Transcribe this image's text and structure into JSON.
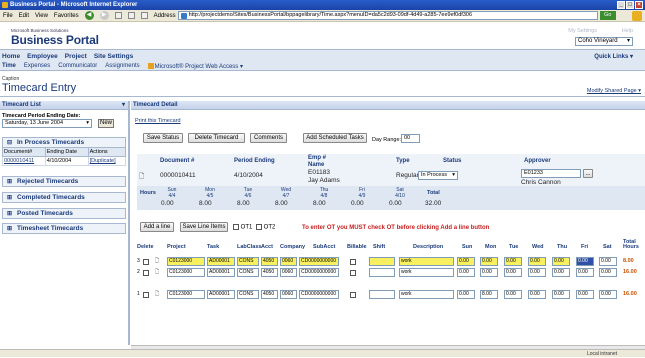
{
  "browser": {
    "title": "Business Portal - Microsoft Internet Explorer",
    "menu": [
      "File",
      "Edit",
      "View",
      "Favorites",
      "Tools",
      "Help"
    ],
    "address_label": "Address",
    "url": "http://projectdemo/Sites/BusinessPortal/bppagelibrary/Time.aspx?menuID=da5c2d93-09df-4d49-a285-7ee9ef0df306",
    "go_label": "Go",
    "status_zone": "Local intranet"
  },
  "portal": {
    "brand_small": "Microsoft Business Solutions",
    "brand": "Business Portal",
    "my_settings": "My Settings",
    "help": "Help",
    "site_select": "Coho Vineyard"
  },
  "nav": {
    "tabs": [
      "Home",
      "Employee",
      "Project",
      "Site Settings"
    ],
    "subtabs": [
      "Time",
      "Expenses",
      "Communicator",
      "Assignments",
      "Microsoft® Project Web Access"
    ],
    "quick_links": "Quick Links"
  },
  "page": {
    "caption": "Caption",
    "title": "Timecard Entry",
    "modify": "Modify Shared Page"
  },
  "timecard_list": {
    "header": "Timecard List",
    "period_label": "Timecard Period Ending Date:",
    "period_value": "Saturday, 13 June 2004",
    "new_button": "New",
    "in_process": "In Process Timecards",
    "table_headers": [
      "Document#",
      "Ending Date",
      "Actions"
    ],
    "rows": [
      {
        "doc": "0000010411",
        "date": "4/10/2004",
        "action": "[Duplicate]"
      }
    ],
    "rejected": "Rejected Timecards",
    "completed": "Completed Timecards",
    "posted": "Posted Timecards",
    "timesheet": "Timesheet Timecards"
  },
  "detail": {
    "header": "Timecard Detail",
    "print_link": "Print this Timecard",
    "save_status": "Save Status",
    "delete_timecard": "Delete Timecard",
    "comments": "Comments",
    "add_scheduled": "Add Scheduled Tasks",
    "day_range_label": "Day Range:",
    "day_range_value": "00",
    "summary_headers": {
      "document": "Document #",
      "period_ending": "Period Ending",
      "emp": "Emp #",
      "name": "Name",
      "type": "Type",
      "status": "Status",
      "approver": "Approver"
    },
    "summary_values": {
      "document": "0000010411",
      "period_ending": "4/10/2004",
      "emp": "E01183",
      "name": "Jay Adams",
      "type": "Regular",
      "status": "In Process",
      "approver_id": "E01233",
      "approver_name": "Chris Cannon",
      "lookup_button": "..."
    },
    "hours_label": "Hours",
    "hours_days": [
      {
        "day": "Sun",
        "date": "4/4",
        "value": "0.00"
      },
      {
        "day": "Mon",
        "date": "4/5",
        "value": "8.00"
      },
      {
        "day": "Tue",
        "date": "4/6",
        "value": "8.00"
      },
      {
        "day": "Wed",
        "date": "4/7",
        "value": "8.00"
      },
      {
        "day": "Thu",
        "date": "4/8",
        "value": "8.00"
      },
      {
        "day": "Fri",
        "date": "4/9",
        "value": "0.00"
      },
      {
        "day": "Sat",
        "date": "4/10",
        "value": "0.00"
      }
    ],
    "total_label": "Total",
    "total_value": "32.00",
    "add_line": "Add a line",
    "save_lines": "Save Line Items",
    "ot1": "OT1",
    "ot2": "OT2",
    "warning": "To enter OT you MUST check OT before clicking Add a line button",
    "grid_headers": [
      "Delete",
      "Project",
      "Task",
      "LabClass",
      "Acct",
      "Company",
      "SubAcct",
      "Billable",
      "Shift",
      "Description",
      "Sun",
      "Mon",
      "Tue",
      "Wed",
      "Thu",
      "Fri",
      "Sat",
      "Total Hours"
    ],
    "lines": [
      {
        "num": "3",
        "project": "C0123000",
        "task": "AD00001",
        "labclass": "CONS",
        "acct": "4050",
        "company": "0060",
        "subacct": "CD0000000000",
        "desc": "work",
        "sun": "0.00",
        "mon": "0.00",
        "tue": "0.00",
        "wed": "0.00",
        "thu": "0.00",
        "fri": "0.00",
        "sat": "0.00",
        "total": "8.00",
        "yellow": true
      },
      {
        "num": "2",
        "project": "C0123000",
        "task": "AD00001",
        "labclass": "CONS",
        "acct": "4050",
        "company": "0060",
        "subacct": "CD0000000000",
        "desc": "work",
        "sun": "0.00",
        "mon": "0.00",
        "tue": "0.00",
        "wed": "0.00",
        "thu": "0.00",
        "fri": "0.00",
        "sat": "0.00",
        "total": "16.00",
        "yellow": false
      },
      {
        "num": "1",
        "project": "C0123000",
        "task": "AD00001",
        "labclass": "CONS",
        "acct": "4050",
        "company": "0060",
        "subacct": "CD0000000000",
        "desc": "work",
        "sun": "0.00",
        "mon": "8.00",
        "tue": "0.00",
        "wed": "0.00",
        "thu": "0.00",
        "fri": "0.00",
        "sat": "0.00",
        "total": "16.00",
        "yellow": false
      }
    ]
  }
}
